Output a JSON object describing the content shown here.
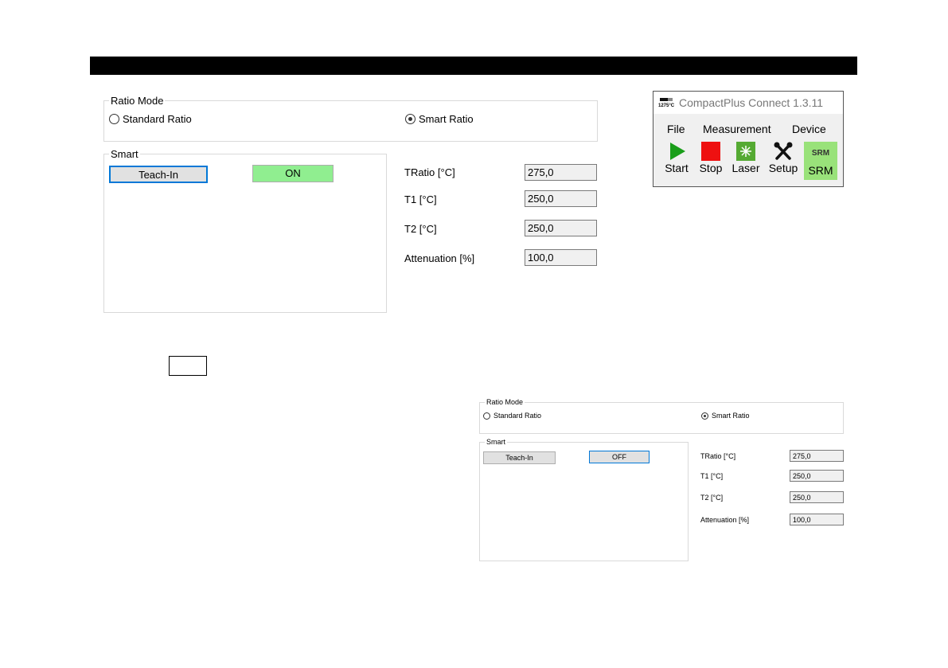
{
  "app": {
    "title": "CompactPlus Connect 1.3.11",
    "logo_text": "1275°C",
    "menu": [
      "File",
      "Measurement",
      "Device"
    ],
    "tools": [
      {
        "label": "Start",
        "icon": "play-icon",
        "color": "#1a9e1a"
      },
      {
        "label": "Stop",
        "icon": "stop-icon",
        "color": "#ee1111"
      },
      {
        "label": "Laser",
        "icon": "laser-icon",
        "color": "#55aa33"
      },
      {
        "label": "Setup",
        "icon": "tools-icon",
        "color": "#111111"
      },
      {
        "label": "SRM",
        "icon": "srm-icon",
        "icon_text": "SRM",
        "color": "#99e27a"
      }
    ]
  },
  "panel_top": {
    "ratio_mode": {
      "legend": "Ratio Mode",
      "options": [
        {
          "label": "Standard Ratio",
          "selected": false
        },
        {
          "label": "Smart Ratio",
          "selected": true
        }
      ]
    },
    "smart": {
      "legend": "Smart",
      "teach_in_label": "Teach-In",
      "state_label": "ON",
      "state_color": "#90ee90"
    },
    "fields": [
      {
        "label": "TRatio [°C]",
        "value": "275,0"
      },
      {
        "label": "T1 [°C]",
        "value": "250,0"
      },
      {
        "label": "T2 [°C]",
        "value": "250,0"
      },
      {
        "label": "Attenuation [%]",
        "value": "100,0"
      }
    ]
  },
  "panel_bottom": {
    "ratio_mode": {
      "legend": "Ratio Mode",
      "options": [
        {
          "label": "Standard Ratio",
          "selected": false
        },
        {
          "label": "Smart Ratio",
          "selected": true
        }
      ]
    },
    "smart": {
      "legend": "Smart",
      "teach_in_label": "Teach-In",
      "state_label": "OFF",
      "state_color": "#e1e1e1"
    },
    "fields": [
      {
        "label": "TRatio [°C]",
        "value": "275,0"
      },
      {
        "label": "T1 [°C]",
        "value": "250,0"
      },
      {
        "label": "T2 [°C]",
        "value": "250,0"
      },
      {
        "label": "Attenuation [%]",
        "value": "100,0"
      }
    ]
  }
}
